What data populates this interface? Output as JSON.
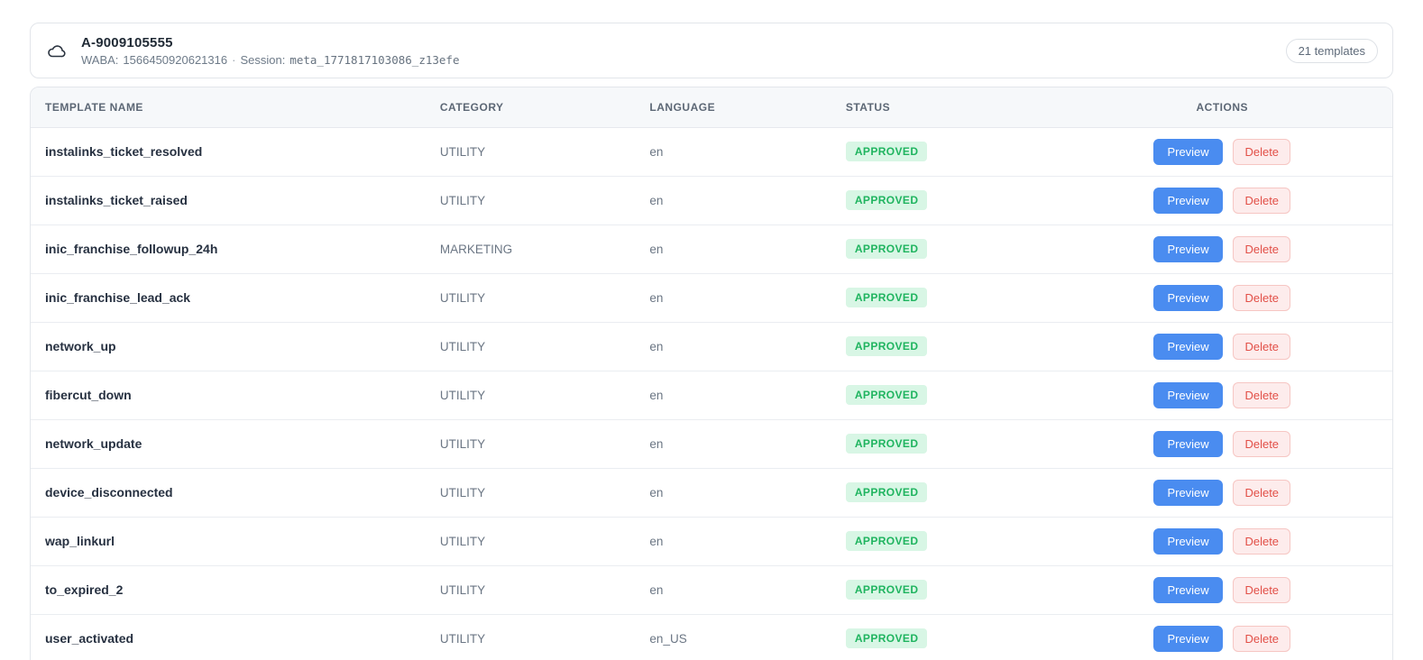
{
  "header": {
    "account_id": "A-9009105555",
    "waba_label": "WABA:",
    "waba_value": "1566450920621316",
    "separator": "·",
    "session_label": "Session:",
    "session_value": "meta_1771817103086_z13efe",
    "templates_count_badge": "21 templates"
  },
  "table": {
    "columns": [
      "Template Name",
      "Category",
      "Language",
      "Status",
      "Actions"
    ],
    "preview_label": "Preview",
    "delete_label": "Delete",
    "rows": [
      {
        "template_name": "instalinks_ticket_resolved",
        "category": "UTILITY",
        "language": "en",
        "status": "APPROVED"
      },
      {
        "template_name": "instalinks_ticket_raised",
        "category": "UTILITY",
        "language": "en",
        "status": "APPROVED"
      },
      {
        "template_name": "inic_franchise_followup_24h",
        "category": "MARKETING",
        "language": "en",
        "status": "APPROVED"
      },
      {
        "template_name": "inic_franchise_lead_ack",
        "category": "UTILITY",
        "language": "en",
        "status": "APPROVED"
      },
      {
        "template_name": "network_up",
        "category": "UTILITY",
        "language": "en",
        "status": "APPROVED"
      },
      {
        "template_name": "fibercut_down",
        "category": "UTILITY",
        "language": "en",
        "status": "APPROVED"
      },
      {
        "template_name": "network_update",
        "category": "UTILITY",
        "language": "en",
        "status": "APPROVED"
      },
      {
        "template_name": "device_disconnected",
        "category": "UTILITY",
        "language": "en",
        "status": "APPROVED"
      },
      {
        "template_name": "wap_linkurl",
        "category": "UTILITY",
        "language": "en",
        "status": "APPROVED"
      },
      {
        "template_name": "to_expired_2",
        "category": "UTILITY",
        "language": "en",
        "status": "APPROVED"
      },
      {
        "template_name": "user_activated",
        "category": "UTILITY",
        "language": "en_US",
        "status": "APPROVED"
      }
    ]
  },
  "colors": {
    "primary_blue": "#4a8cf0",
    "status_green_text": "#1fb45f",
    "status_green_bg": "#d8f6e5",
    "delete_red_text": "#e25048",
    "delete_red_bg": "#fdecec",
    "card_border": "#e3e6eb",
    "table_header_bg": "#f6f8fa"
  }
}
